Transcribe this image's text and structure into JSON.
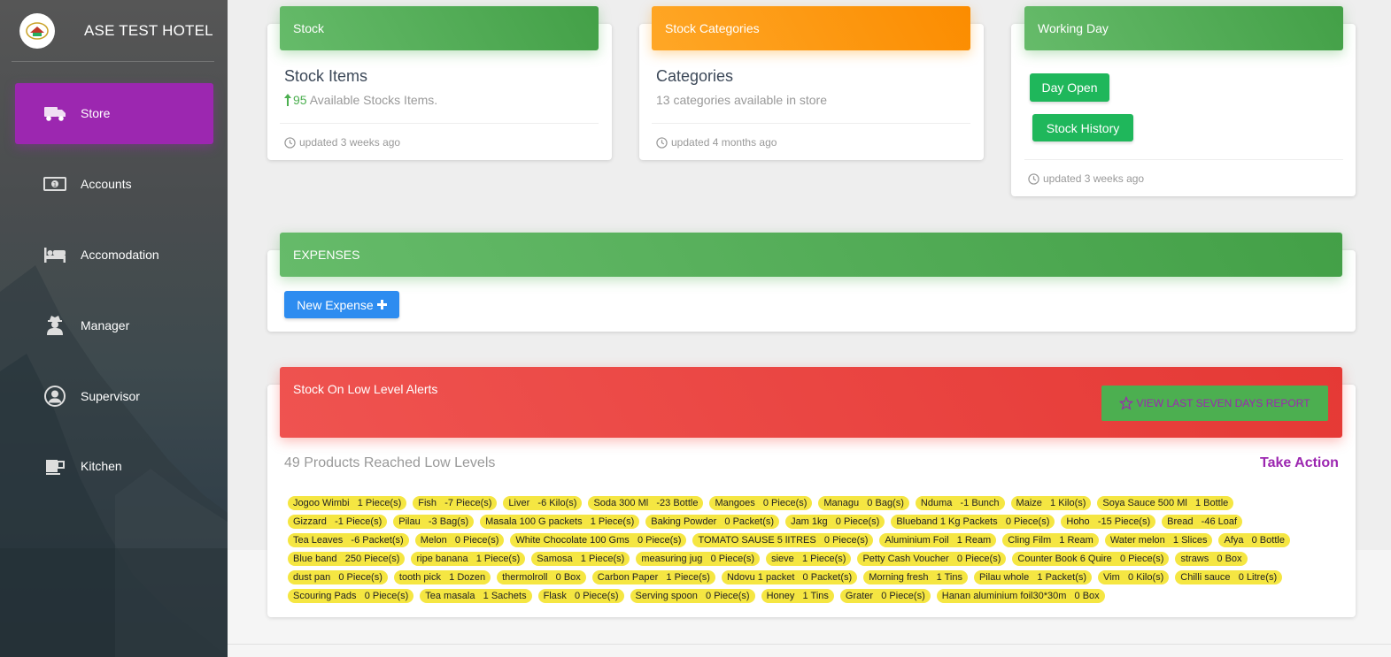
{
  "sidebar": {
    "brand_title": "ASE TEST HOTEL",
    "items": [
      {
        "label": "Store",
        "icon": "truck-icon",
        "active": true
      },
      {
        "label": "Accounts",
        "icon": "money-icon",
        "active": false
      },
      {
        "label": "Accomodation",
        "icon": "bed-icon",
        "active": false
      },
      {
        "label": "Manager",
        "icon": "user-secret-icon",
        "active": false
      },
      {
        "label": "Supervisor",
        "icon": "user-circle-icon",
        "active": false
      },
      {
        "label": "Kitchen",
        "icon": "coffee-icon",
        "active": false
      }
    ]
  },
  "cards": {
    "stock": {
      "header": "Stock",
      "title": "Stock Items",
      "count": "95",
      "sub": " Available Stocks Items.",
      "footer": "updated 3 weeks ago"
    },
    "categories": {
      "header": "Stock Categories",
      "title": "Categories",
      "sub": "13 categories available in store",
      "footer": "updated 4 months ago"
    },
    "working_day": {
      "header": "Working Day",
      "day_open_label": "Day Open",
      "stock_history_label": "Stock History",
      "footer": "updated 3 weeks ago"
    },
    "expenses": {
      "header": "EXPENSES",
      "new_expense_label": "New Expense"
    },
    "low_stock": {
      "header": "Stock On Low Level Alerts",
      "report_label": "VIEW LAST SEVEN DAYS REPORT",
      "count_text": "49 Products Reached Low Levels",
      "take_action_label": "Take Action",
      "items": [
        "Jogoo Wimbi   1 Piece(s)",
        "Fish   -7 Piece(s)",
        "Liver   -6 Kilo(s)",
        "Soda 300 Ml   -23 Bottle",
        "Mangoes   0 Piece(s)",
        "Managu   0 Bag(s)",
        "Nduma   -1 Bunch",
        "Maize   1 Kilo(s)",
        "Soya Sauce 500 Ml   1 Bottle",
        "Gizzard   -1 Piece(s)",
        "Pilau   -3 Bag(s)",
        "Masala 100 G packets   1 Piece(s)",
        "Baking Powder   0 Packet(s)",
        "Jam 1kg   0 Piece(s)",
        "Blueband 1 Kg Packets   0 Piece(s)",
        "Hoho   -15 Piece(s)",
        "Bread   -46 Loaf",
        "Tea Leaves   -6 Packet(s)",
        "Melon   0 Piece(s)",
        "White Chocolate 100 Gms   0 Piece(s)",
        "TOMATO SAUSE 5 lITRES   0 Piece(s)",
        "Aluminium Foil   1 Ream",
        "Cling Film   1 Ream",
        "Water melon   1 Slices",
        "Afya   0 Bottle",
        "Blue band   250 Piece(s)",
        "ripe banana   1 Piece(s)",
        "Samosa   1 Piece(s)",
        "measuring jug   0 Piece(s)",
        "sieve   1 Piece(s)",
        "Petty Cash Voucher   0 Piece(s)",
        "Counter Book 6 Quire   0 Piece(s)",
        "straws   0 Box",
        "dust pan   0 Piece(s)",
        "tooth pick   1 Dozen",
        "thermolroll   0 Box",
        "Carbon Paper   1 Piece(s)",
        "Ndovu 1 packet   0 Packet(s)",
        "Morning fresh   1 Tins",
        "Pilau whole   1 Packet(s)",
        "Vim   0 Kilo(s)",
        "Chilli sauce   0 Litre(s)",
        "Scouring Pads   0 Piece(s)",
        "Tea masala   1 Sachets",
        "Flask   0 Piece(s)",
        "Serving spoon   0 Piece(s)",
        "Honey   1 Tins",
        "Grater   0 Piece(s)",
        "Hanan aluminium foil30*30m   0 Box"
      ]
    }
  },
  "colors": {
    "active_nav": "#9c27b0",
    "green": "#4caf50",
    "orange": "#ff9800",
    "red": "#f44336",
    "tag_yellow": "#f5e642",
    "blue_button": "#2d8cf0"
  }
}
